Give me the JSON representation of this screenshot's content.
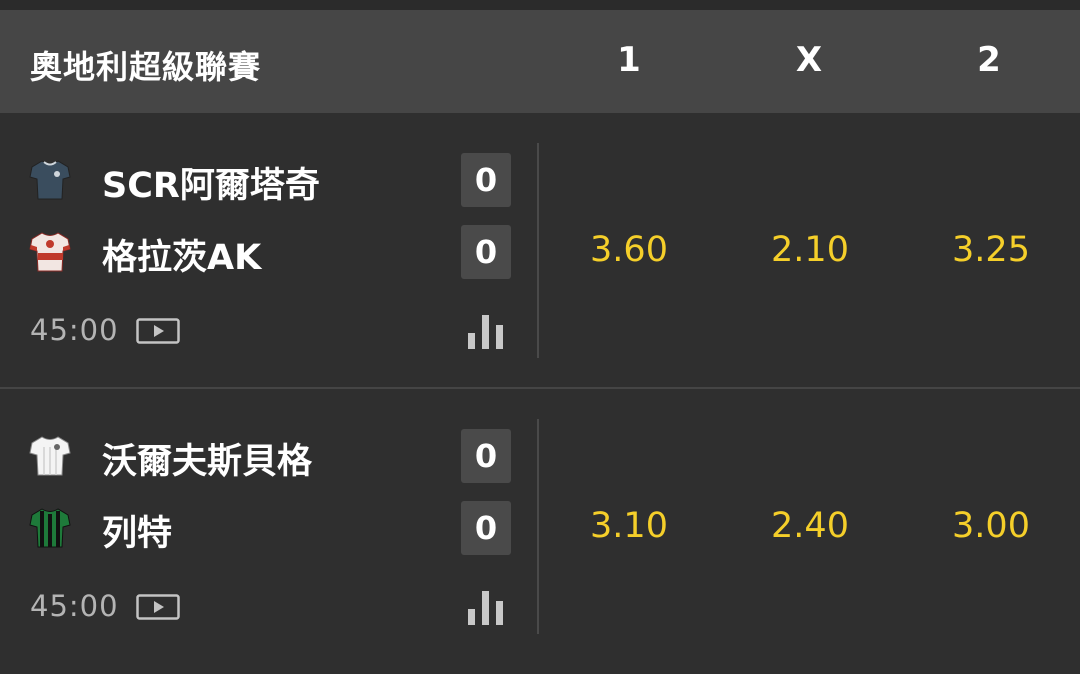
{
  "header": {
    "league": "奧地利超級聯賽",
    "col_home": "1",
    "col_draw": "X",
    "col_away": "2"
  },
  "matches": [
    {
      "home": {
        "name": "SCR阿爾塔奇",
        "score": "0",
        "jersey": "navy-shirt-icon"
      },
      "away": {
        "name": "格拉茨AK",
        "score": "0",
        "jersey": "red-white-shirt-icon"
      },
      "time": "45:00",
      "odds": {
        "home": "3.60",
        "draw": "2.10",
        "away": "3.25"
      }
    },
    {
      "home": {
        "name": "沃爾夫斯貝格",
        "score": "0",
        "jersey": "white-shirt-icon"
      },
      "away": {
        "name": "列特",
        "score": "0",
        "jersey": "green-black-striped-shirt-icon"
      },
      "time": "45:00",
      "odds": {
        "home": "3.10",
        "draw": "2.40",
        "away": "3.00"
      }
    }
  ],
  "colors": {
    "background": "#2f2f2f",
    "header_bg": "#464646",
    "odds": "#f5cf2a",
    "score_box": "#4a4a4a",
    "clock_text": "#b4b4b4"
  }
}
